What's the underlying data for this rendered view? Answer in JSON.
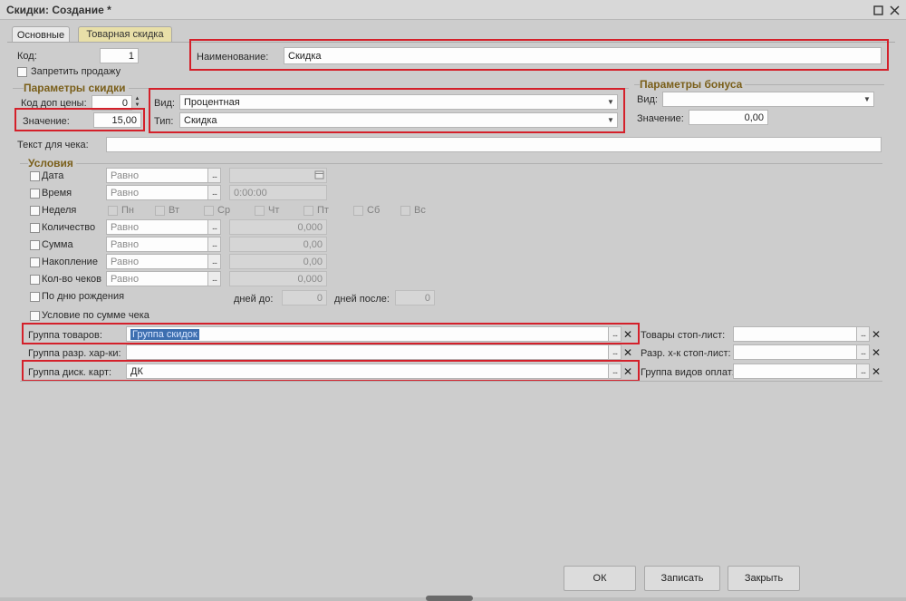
{
  "window": {
    "title": "Скидки: Создание *"
  },
  "tabs": [
    {
      "label": "Основные"
    },
    {
      "label": "Товарная скидка"
    }
  ],
  "main": {
    "code_label": "Код:",
    "code_value": "1",
    "name_label": "Наименование:",
    "name_value": "Скидка",
    "forbid_sale_label": "Запретить продажу",
    "receipt_text_label": "Текст для чека:"
  },
  "discount_params": {
    "title": "Параметры скидки",
    "price_code_label": "Код доп цены:",
    "price_code_value": "0",
    "value_label": "Значение:",
    "value": "15,00",
    "kind_label": "Вид:",
    "kind_value": "Процентная",
    "type_label": "Тип:",
    "type_value": "Скидка"
  },
  "bonus_params": {
    "title": "Параметры бонуса",
    "kind_label": "Вид:",
    "value_label": "Значение:",
    "value": "0,00"
  },
  "conditions": {
    "title": "Условия",
    "date_label": "Дата",
    "time_label": "Время",
    "week_label": "Неделя",
    "quantity_label": "Количество",
    "sum_label": "Сумма",
    "accum_label": "Накопление",
    "checks_label": "Кол-во чеков",
    "birthday_label": "По дню рождения",
    "check_sum_label": "Условие по сумме чека",
    "equal_text": "Равно",
    "time_value": "0:00:00",
    "zero_decimal": "0,000",
    "zero_money": "0,00",
    "zero_int": "0",
    "days_before_label": "дней до:",
    "days_after_label": "дней после:",
    "days": [
      "Пн",
      "Вт",
      "Ср",
      "Чт",
      "Пт",
      "Сб",
      "Вс"
    ]
  },
  "groups": {
    "goods_group_label": "Группа товаров:",
    "goods_group_value": "Группа скидок",
    "char_group_label": "Группа разр. хар-ки:",
    "card_group_label": "Группа диск. карт:",
    "card_group_value": "ДК",
    "stop_goods_label": "Товары стоп-лист:",
    "stop_char_label": "Разр. х-к стоп-лист:",
    "payment_group_label": "Группа видов оплат:"
  },
  "buttons": {
    "ok": "ОК",
    "save": "Записать",
    "close": "Закрыть"
  },
  "colors": {
    "highlight": "#d4202a",
    "group_title": "#7a5f1a",
    "selection": "#3d6fb0"
  }
}
